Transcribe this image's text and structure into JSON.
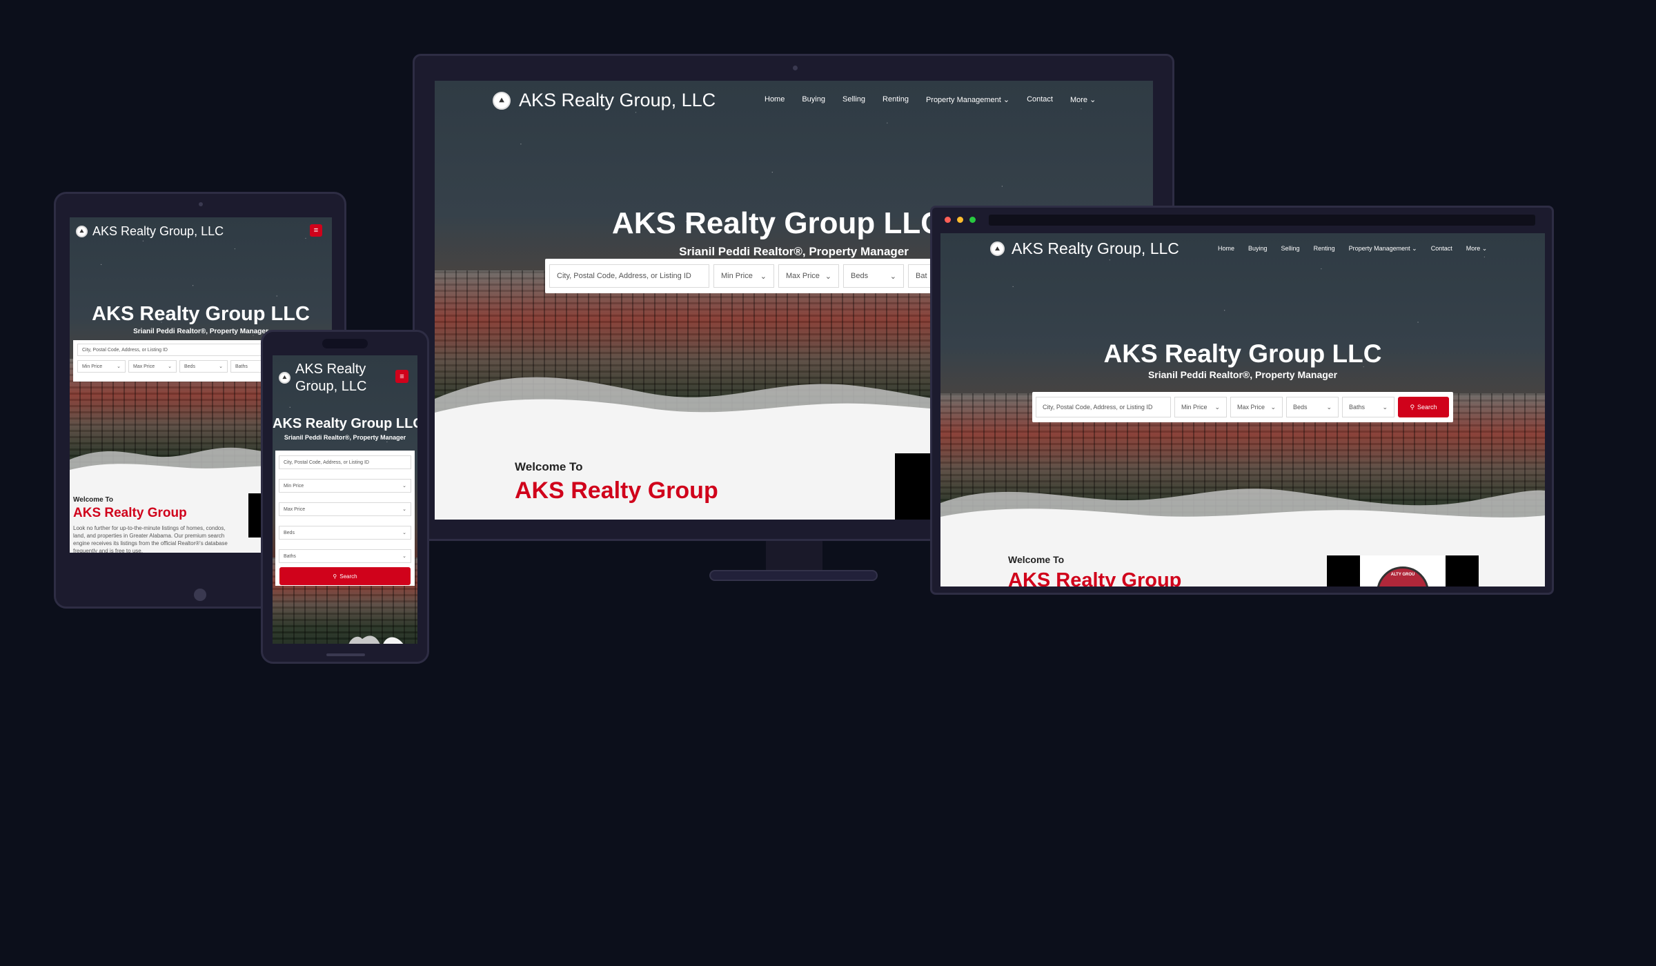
{
  "site": {
    "brand": "AKS Realty Group, LLC",
    "brand_line1": "AKS Realty",
    "brand_line2": "Group, LLC",
    "hero_title": "AKS Realty Group LLC",
    "hero_title_clipped": "AKS Realty Group LLC",
    "hero_subtitle": "Srianil Peddi Realtor®, Property Manager",
    "nav": [
      "Home",
      "Buying",
      "Selling",
      "Renting",
      "Property Management",
      "Contact",
      "More"
    ],
    "search": {
      "placeholder": "City, Postal Code, Address, or Listing ID",
      "min_price": "Min Price",
      "max_price": "Max Price",
      "beds": "Beds",
      "baths": "Baths",
      "baths_clipped": "Bat",
      "baths_clipped_tablet": "Baths",
      "button": "Search"
    },
    "welcome_to": "Welcome To",
    "welcome_brand": "AKS Realty Group",
    "intro": "Look no further for up-to-the-minute listings of homes, condos, land, and properties in Greater Alabama. Our premium search engine receives its listings from the official Realtor®'s database frequently and is free to use.",
    "logo_text": "ALTY GROU"
  },
  "colors": {
    "background": "#0c0f1b",
    "accent": "#d0021b",
    "device_frame": "#1c1b2e"
  },
  "icons": {
    "menu": "hamburger-icon",
    "caret": "chevron-down-icon",
    "search": "search-icon",
    "logo": "mountain-logo-icon"
  }
}
